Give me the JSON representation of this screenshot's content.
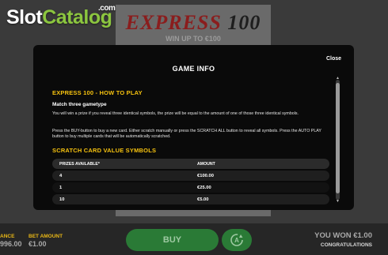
{
  "watermark": {
    "part1": "Slot",
    "part2": "Catalog",
    "suffix": ".com"
  },
  "game": {
    "logo_word1": "EXPRESS",
    "logo_word2": "100",
    "subtitle": "WIN UP TO €100"
  },
  "modal": {
    "title": "GAME INFO",
    "close_label": "Close",
    "how_to_play_heading": "EXPRESS 100 - HOW TO PLAY",
    "gametype_heading": "Match three gametype",
    "para1": "You will win a prize if you reveal three identical symbols, the prize will be equal to the amount of one of those three identical symbols.",
    "para2": "Press the BUY-button to buy a new card. Either scratch manually or press the SCRATCH ALL button to reveal all symbols. Press the AUTO PLAY button to buy multiple cards that will be automatically scratched.",
    "values_heading": "SCRATCH CARD VALUE SYMBOLS",
    "table": {
      "headers": [
        "PRIZES AVAILABLE*",
        "AMOUNT"
      ],
      "rows": [
        {
          "prizes": "4",
          "amount": "€100.00"
        },
        {
          "prizes": "1",
          "amount": "€25.00"
        },
        {
          "prizes": "10",
          "amount": "€5.00"
        }
      ]
    }
  },
  "footer": {
    "balance_label": "ANCE",
    "balance_value": "996.00",
    "bet_label": "BET AMOUNT",
    "bet_value": "€1.00",
    "buy_label": "BUY",
    "autoplay_icon": "autoplay-icon",
    "won_text": "YOU WON €1.00",
    "won_sub": "CONGRATULATIONS"
  },
  "colors": {
    "accent_yellow": "#f6c20f",
    "button_green": "#2a7a36",
    "modal_bg": "#0a0a0a",
    "watermark_green": "#8cc63f"
  }
}
